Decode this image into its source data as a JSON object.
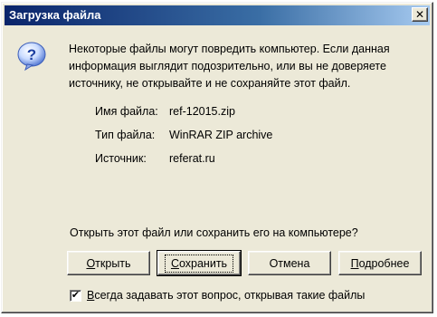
{
  "window": {
    "title": "Загрузка файла",
    "close_glyph": "✕"
  },
  "icon": {
    "name": "question-icon"
  },
  "message": "Некоторые файлы могут повредить компьютер. Если данная информация выглядит подозрительно, или вы не доверяете источнику, не открывайте и не сохраняйте этот файл.",
  "file_info": {
    "name_label": "Имя файла:",
    "name_value": "ref-12015.zip",
    "type_label": "Тип файла:",
    "type_value": "WinRAR ZIP archive",
    "source_label": "Источник:",
    "source_value": "referat.ru"
  },
  "question": "Открыть этот файл или сохранить его на компьютере?",
  "buttons": {
    "open": {
      "mnemonic": "О",
      "rest": "ткрыть"
    },
    "save": {
      "mnemonic": "С",
      "rest": "охранить"
    },
    "cancel": {
      "label": "Отмена"
    },
    "more": {
      "mnemonic": "П",
      "rest": "одробнее"
    }
  },
  "checkbox": {
    "checked": true,
    "mark": "✔",
    "mnemonic": "В",
    "rest": "сегда задавать этот вопрос, открывая такие файлы"
  }
}
